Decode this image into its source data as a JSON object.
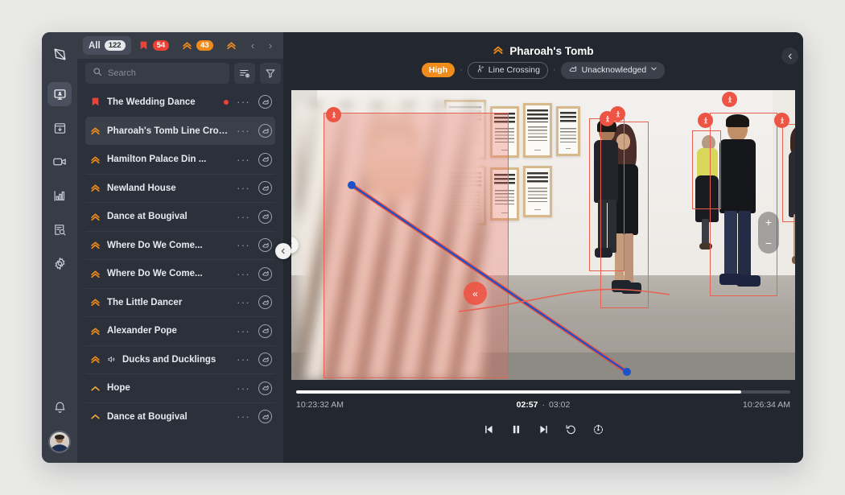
{
  "rail": {
    "items": [
      {
        "name": "logo",
        "icon": "gem-logo-icon",
        "active": false
      },
      {
        "name": "alerts",
        "icon": "monitor-alert-icon",
        "active": true
      },
      {
        "name": "archive",
        "icon": "archive-download-icon",
        "active": false
      },
      {
        "name": "cameras",
        "icon": "video-camera-icon",
        "active": false
      },
      {
        "name": "analytics",
        "icon": "bar-chart-icon",
        "active": false
      },
      {
        "name": "investigate",
        "icon": "document-search-icon",
        "active": false
      },
      {
        "name": "settings",
        "icon": "gear-icon",
        "active": false
      }
    ],
    "bell": "notifications-bell-icon",
    "avatar": "user-avatar"
  },
  "filters": {
    "tabs": [
      {
        "label": "All",
        "count": "122",
        "style": "all",
        "selected": true
      },
      {
        "label": "",
        "count": "54",
        "style": "crit",
        "icon": "critical-flag-icon",
        "selected": false
      },
      {
        "label": "",
        "count": "43",
        "style": "high",
        "icon": "high-chevrons-icon",
        "selected": false
      },
      {
        "label": "",
        "count": "",
        "style": "medium",
        "icon": "medium-chevrons-icon",
        "selected": false
      }
    ],
    "prev": "‹",
    "next": "›"
  },
  "search": {
    "placeholder": "Search",
    "value": "",
    "sort_icon": "sort-settings-icon",
    "filter_icon": "funnel-filter-icon"
  },
  "alerts": [
    {
      "name": "The Wedding Dance",
      "severity": "critical",
      "live": true,
      "audio": false,
      "selected": false
    },
    {
      "name": "Pharoah's Tomb Line Cross",
      "severity": "high",
      "live": false,
      "audio": false,
      "selected": true
    },
    {
      "name": "Hamilton Palace Din ...",
      "severity": "high",
      "live": false,
      "audio": false,
      "selected": false
    },
    {
      "name": "Newland House",
      "severity": "high",
      "live": false,
      "audio": false,
      "selected": false
    },
    {
      "name": "Dance at Bougival",
      "severity": "high",
      "live": false,
      "audio": false,
      "selected": false
    },
    {
      "name": "Where Do We Come...",
      "severity": "high",
      "live": false,
      "audio": false,
      "selected": false
    },
    {
      "name": "Where Do We Come...",
      "severity": "high",
      "live": false,
      "audio": false,
      "selected": false
    },
    {
      "name": "The Little Dancer",
      "severity": "high",
      "live": false,
      "audio": false,
      "selected": false
    },
    {
      "name": "Alexander Pope",
      "severity": "high",
      "live": false,
      "audio": false,
      "selected": false
    },
    {
      "name": "Ducks and Ducklings",
      "severity": "high",
      "live": false,
      "audio": true,
      "selected": false
    },
    {
      "name": "Hope",
      "severity": "medium",
      "live": false,
      "audio": false,
      "selected": false
    },
    {
      "name": "Dance at Bougival",
      "severity": "medium",
      "live": false,
      "audio": false,
      "selected": false
    }
  ],
  "row_menu_label": "···",
  "detail": {
    "title": "Pharoah's Tomb",
    "severity_icon": "high-chevrons-icon",
    "priority": "High",
    "event_type": "Line Crossing",
    "event_type_icon": "line-crossing-icon",
    "status": "Unacknowledged",
    "status_icon": "acknowledge-hand-icon",
    "status_caret": "∨",
    "dot": "·",
    "collapse_icon": "chevron-left-icon"
  },
  "video": {
    "rewind_label": "«",
    "zoom_in": "+",
    "zoom_out": "−",
    "detection_badge_icon": "pedestrian-icon",
    "detections": 7
  },
  "transport": {
    "start_time": "10:23:32 AM",
    "end_time": "10:26:34 AM",
    "current_time": "02:57",
    "total_time": "03:02",
    "separator": "·",
    "progress_percent": 90,
    "controls": [
      {
        "name": "previous-frame-button",
        "icon": "skip-back-icon"
      },
      {
        "name": "pause-button",
        "icon": "pause-icon"
      },
      {
        "name": "next-frame-button",
        "icon": "skip-forward-icon"
      },
      {
        "name": "restart-button",
        "icon": "rotate-ccw-icon"
      },
      {
        "name": "playback-speed-button",
        "icon": "clock-play-icon"
      }
    ]
  },
  "colors": {
    "critical": "#ef4136",
    "high": "#f08c1c",
    "detection": "#ee5444",
    "panel": "#2b303a",
    "rail": "#373c47"
  }
}
